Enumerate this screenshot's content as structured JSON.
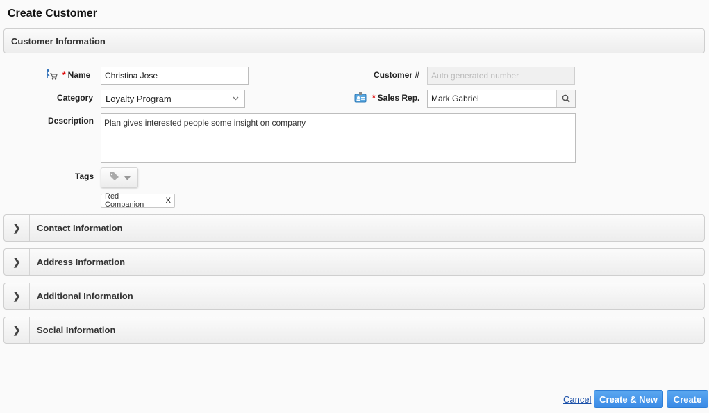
{
  "page": {
    "title": "Create Customer"
  },
  "sections": {
    "customer_info": "Customer Information",
    "contact": "Contact Information",
    "address": "Address Information",
    "additional": "Additional Information",
    "social": "Social Information",
    "toggle_glyph": "❯"
  },
  "form": {
    "required_marker": "*",
    "name": {
      "label": "Name",
      "value": "Christina Jose"
    },
    "customer_number": {
      "label": "Customer #",
      "placeholder": "Auto generated number"
    },
    "category": {
      "label": "Category",
      "value": "Loyalty Program"
    },
    "sales_rep": {
      "label": "Sales Rep.",
      "value": "Mark Gabriel"
    },
    "description": {
      "label": "Description",
      "value": "Plan gives interested people some insight on company"
    },
    "tags": {
      "label": "Tags",
      "items": [
        {
          "label": "Red Companion",
          "remove": "X"
        }
      ]
    }
  },
  "actions": {
    "cancel": "Cancel",
    "create_new": "Create & New",
    "create": "Create"
  },
  "icons": {
    "name_icon": "customer-cart-icon",
    "sales_rep_icon": "id-card-icon",
    "search": "search-icon",
    "tag": "tag-icon"
  },
  "colors": {
    "primary_button": "#3a8ae6",
    "required": "#dd0000",
    "link": "#1a4fa8"
  }
}
